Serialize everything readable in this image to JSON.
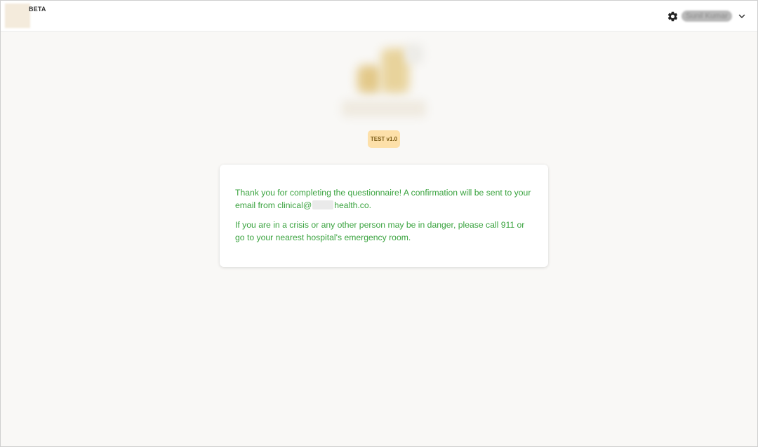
{
  "header": {
    "badge": "BETA",
    "user_name": "Sunil Kumar",
    "icons": {
      "settings": "gear-icon",
      "menu": "chevron-down-icon"
    }
  },
  "version_badge": "TEST v1.0",
  "message": {
    "confirmation_before": "Thank you for completing the questionnaire! A confirmation will be sent to your email from clinical@",
    "confirmation_after": "health.co.",
    "crisis": "If you are in a crisis or any other person may be in danger, please call 911 or go to your nearest hospital's emergency room."
  },
  "colors": {
    "accent_text": "#3aa33f",
    "badge_bg": "#fde0a9",
    "page_bg": "#f9f8f6"
  }
}
